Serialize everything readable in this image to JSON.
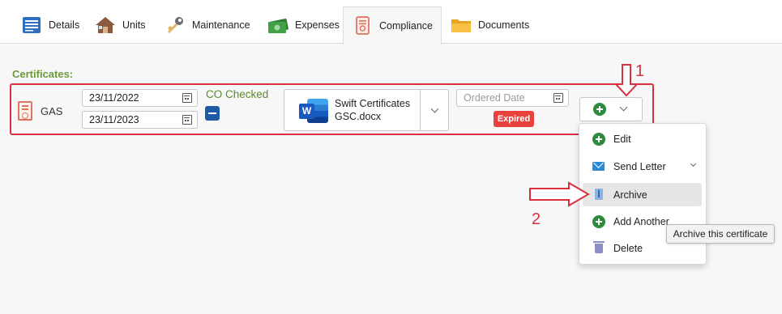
{
  "tabs": [
    {
      "label": "Details",
      "icon": "details-icon",
      "active": false
    },
    {
      "label": "Units",
      "icon": "house-icon",
      "active": false
    },
    {
      "label": "Maintenance",
      "icon": "wrench-icon",
      "active": false
    },
    {
      "label": "Expenses",
      "icon": "money-icon",
      "active": false
    },
    {
      "label": "Compliance",
      "icon": "certificate-icon",
      "active": true
    },
    {
      "label": "Documents",
      "icon": "folder-icon",
      "active": false
    }
  ],
  "certificates": {
    "title": "Certificates:",
    "row": {
      "type": "GAS",
      "start_date": "23/11/2022",
      "end_date": "23/11/2023",
      "co_label": "CO Checked",
      "document_name": "Swift Certificates GSC.docx",
      "ordered_date_placeholder": "Ordered Date",
      "status": "Expired"
    }
  },
  "menu": {
    "items": [
      {
        "label": "Edit",
        "icon": "plus-circle-icon"
      },
      {
        "label": "Send Letter",
        "icon": "mail-icon",
        "has_submenu": true
      },
      {
        "label": "Archive",
        "icon": "archive-icon",
        "hovered": true
      },
      {
        "label": "Add Another",
        "icon": "plus-circle-icon"
      },
      {
        "label": "Delete",
        "icon": "trash-icon"
      }
    ]
  },
  "tooltip": "Archive this certificate",
  "annotations": {
    "step1": "1",
    "step2": "2"
  },
  "colors": {
    "accent_green": "#6a9a3a",
    "highlight_red": "#d9303e",
    "expired": "#e9423e",
    "toggle_blue": "#1e5aa6"
  }
}
